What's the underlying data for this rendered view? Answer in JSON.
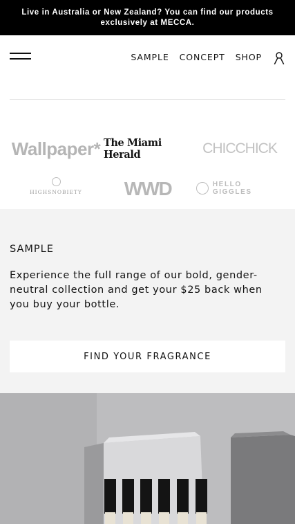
{
  "announcement": {
    "text": "Live in Australia or New Zealand? You can find our products exclusively at MECCA."
  },
  "header": {
    "nav": [
      {
        "label": "SAMPLE"
      },
      {
        "label": "CONCEPT"
      },
      {
        "label": "SHOP"
      }
    ],
    "icons": {
      "menu": "hamburger-menu-icon",
      "account": "user-account-icon"
    }
  },
  "press": {
    "logos": {
      "wallpaper": "Wallpaper*",
      "miami_herald": "The Miami Herald",
      "chic_chick": "CHICCHICK",
      "highsnobiety": "HIGHSNOBIETY",
      "wwd": "WWD",
      "hello_giggles": "HELLO GIGGLES"
    }
  },
  "sample": {
    "title": "SAMPLE",
    "body": "Experience the full range of our bold, gender-neutral collection and get your $25 back when you buy your bottle.",
    "cta_label": "FIND YOUR FRAGRANCE",
    "background": "#f3f3f3"
  },
  "colors": {
    "announcement_bg": "#000000",
    "text": "#111111",
    "section_bg": "#f3f3f3"
  }
}
